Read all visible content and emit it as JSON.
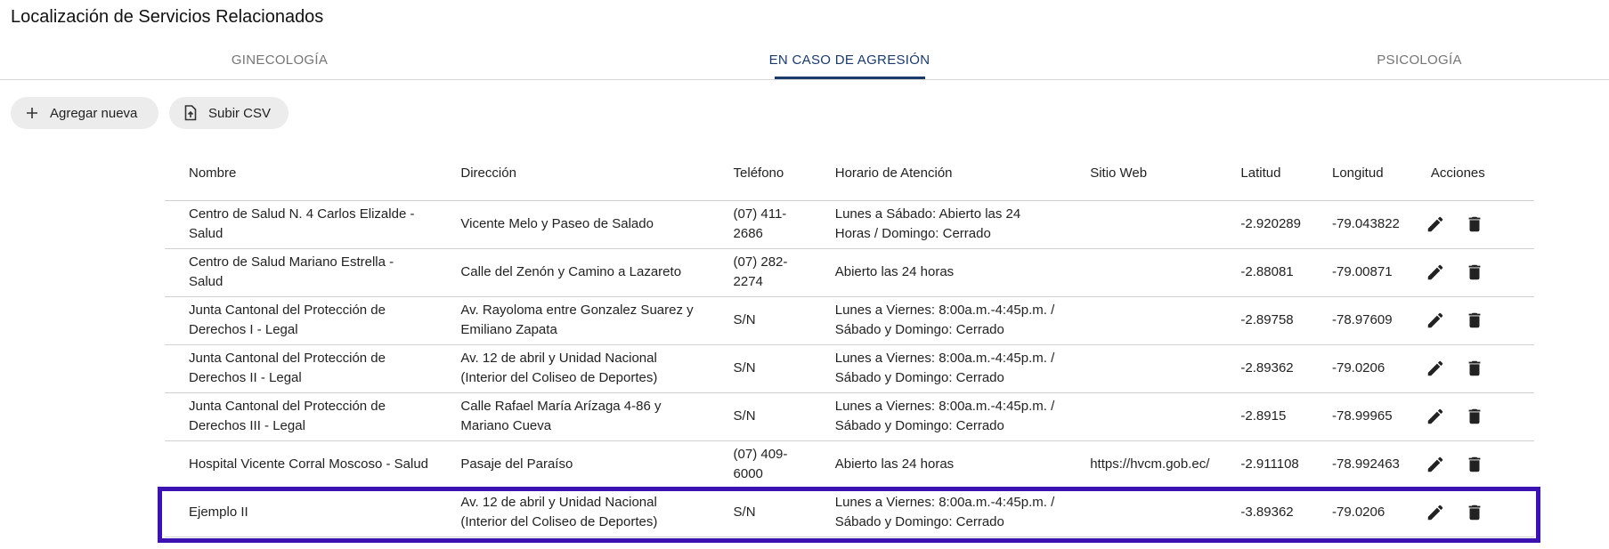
{
  "page_title": "Localización de Servicios Relacionados",
  "tabs": [
    {
      "label": "GINECOLOGÍA"
    },
    {
      "label": "EN CASO DE AGRESIÓN",
      "active": true
    },
    {
      "label": "PSICOLOGÍA"
    }
  ],
  "toolbar": {
    "add_label": "Agregar nueva",
    "add_icon": "plus-icon",
    "upload_label": "Subir CSV",
    "upload_icon": "file-upload-icon"
  },
  "table": {
    "columns": [
      "Nombre",
      "Dirección",
      "Teléfono",
      "Horario de Atención",
      "Sitio Web",
      "Latitud",
      "Longitud",
      "Acciones"
    ],
    "rows": [
      {
        "nombre": "Centro de Salud N. 4 Carlos Elizalde - Salud",
        "direccion": "Vicente Melo y Paseo de Salado",
        "telefono": "(07) 411-2686",
        "horario": "Lunes a Sábado: Abierto las 24 Horas / Domingo: Cerrado",
        "web": "",
        "lat": "-2.920289",
        "lng": "-79.043822"
      },
      {
        "nombre": "Centro de Salud Mariano Estrella - Salud",
        "direccion": "Calle del Zenón y Camino a Lazareto",
        "telefono": "(07) 282-2274",
        "horario": "Abierto las 24 horas",
        "web": "",
        "lat": "-2.88081",
        "lng": "-79.00871"
      },
      {
        "nombre": "Junta Cantonal del Protección de Derechos I - Legal",
        "direccion": "Av. Rayoloma entre Gonzalez Suarez y Emiliano Zapata",
        "telefono": "S/N",
        "horario": "Lunes a Viernes: 8:00a.m.-4:45p.m. / Sábado y Domingo: Cerrado",
        "web": "",
        "lat": "-2.89758",
        "lng": "-78.97609"
      },
      {
        "nombre": "Junta Cantonal del Protección de Derechos II - Legal",
        "direccion": "Av. 12 de abril y Unidad Nacional (Interior del Coliseo de Deportes)",
        "telefono": "S/N",
        "horario": "Lunes a Viernes: 8:00a.m.-4:45p.m. / Sábado y Domingo: Cerrado",
        "web": "",
        "lat": "-2.89362",
        "lng": "-79.0206"
      },
      {
        "nombre": "Junta Cantonal del Protección de Derechos III - Legal",
        "direccion": "Calle Rafael María Arízaga 4-86 y Mariano Cueva",
        "telefono": "S/N",
        "horario": "Lunes a Viernes: 8:00a.m.-4:45p.m. / Sábado y Domingo: Cerrado",
        "web": "",
        "lat": "-2.8915",
        "lng": "-78.99965"
      },
      {
        "nombre": "Hospital Vicente Corral Moscoso - Salud",
        "direccion": "Pasaje del Paraíso",
        "telefono": "(07) 409-6000",
        "horario": "Abierto las 24 horas",
        "web": "https://hvcm.gob.ec/",
        "lat": "-2.911108",
        "lng": "-78.992463"
      },
      {
        "nombre": "Ejemplo II",
        "direccion": "Av. 12 de abril y Unidad Nacional (Interior del Coliseo de Deportes)",
        "telefono": "S/N",
        "horario": "Lunes a Viernes: 8:00a.m.-4:45p.m. / Sábado y Domingo: Cerrado",
        "web": "",
        "lat": "-3.89362",
        "lng": "-79.0206"
      }
    ],
    "row_actions": [
      "edit-icon",
      "delete-icon"
    ]
  },
  "colors": {
    "accent": "#1a3a6b",
    "highlight": "#3d12b3"
  }
}
